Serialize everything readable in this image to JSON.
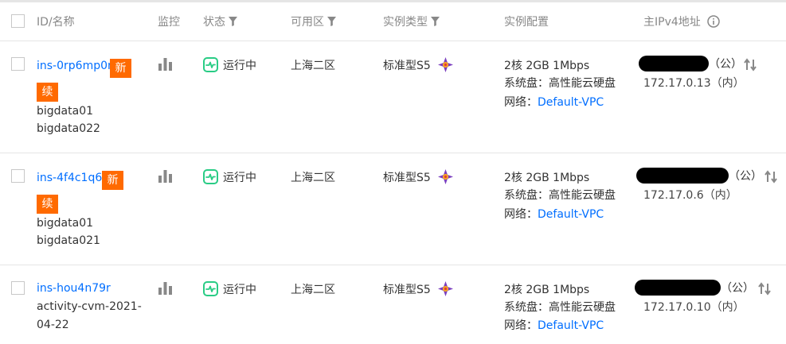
{
  "header": {
    "id_name": "ID/名称",
    "monitor": "监控",
    "status": "状态",
    "zone": "可用区",
    "instance_type": "实例类型",
    "config": "实例配置",
    "ipv4": "主IPv4地址"
  },
  "rows": [
    {
      "id": "ins-0rp6mp0n",
      "badge_top": "新",
      "badge_bottom": "续",
      "names": [
        "bigdata01",
        "bigdata022"
      ],
      "status": "运行中",
      "zone": "上海二区",
      "type": "标准型S5",
      "config": "2核 2GB 1Mbps",
      "disk": "系统盘：高性能云硬盘",
      "network_label": "网络：",
      "network": "Default-VPC",
      "public_suffix": "（公）",
      "private_ip": "172.17.0.13（内）"
    },
    {
      "id": "ins-4f4c1q6j",
      "badge_top": "新",
      "badge_bottom": "续",
      "names": [
        "bigdata01",
        "bigdata021"
      ],
      "status": "运行中",
      "zone": "上海二区",
      "type": "标准型S5",
      "config": "2核 2GB 1Mbps",
      "disk": "系统盘：高性能云硬盘",
      "network_label": "网络：",
      "network": "Default-VPC",
      "public_suffix": "（公）",
      "private_ip": "172.17.0.6（内）"
    },
    {
      "id": "ins-hou4n79r",
      "names": [
        "activity-cvm-2021-",
        "04-22"
      ],
      "status": "运行中",
      "zone": "上海二区",
      "type": "标准型S5",
      "config": "2核 2GB 1Mbps",
      "disk": "系统盘：高性能云硬盘",
      "network_label": "网络：",
      "network": "Default-VPC",
      "public_suffix": "（公）",
      "private_ip": "172.17.0.10（内）"
    }
  ],
  "colors": {
    "link": "#006eff",
    "badge": "#ff6a00",
    "status_green": "#29cc85"
  },
  "icons": {
    "monitor": "bar-chart-icon",
    "status": "running-status-icon",
    "type": "cpu-type-icon",
    "swap": "swap-ip-icon",
    "info": "info-icon",
    "filter": "filter-icon"
  }
}
